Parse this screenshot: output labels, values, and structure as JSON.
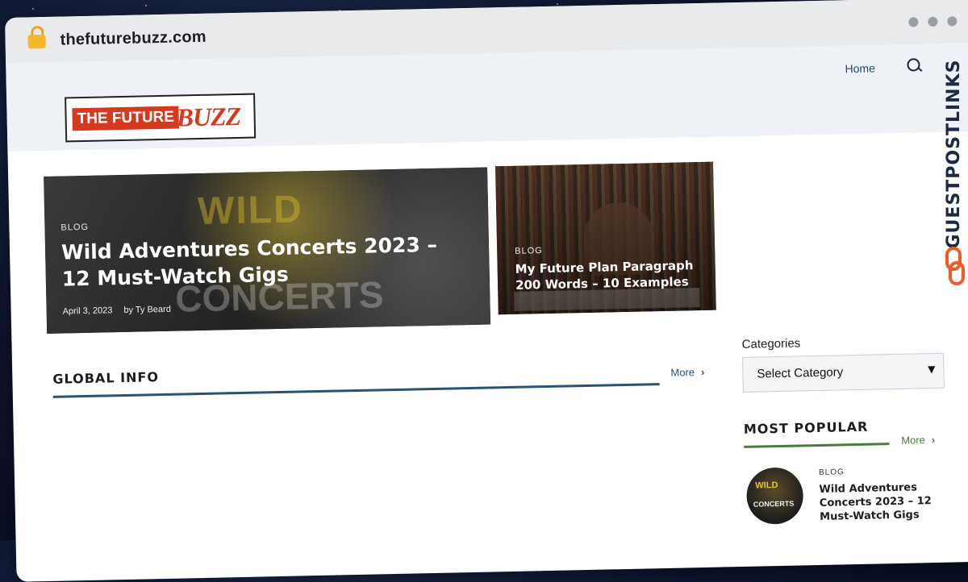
{
  "browser": {
    "url": "thefuturebuzz.com"
  },
  "header": {
    "logo_part1": "THE FUTURE",
    "logo_part2": "BUZZ",
    "nav_home": "Home"
  },
  "hero": {
    "category": "BLOG",
    "title": "Wild Adventures Concerts 2023 – 12 Must-Watch Gigs",
    "date": "April 3, 2023",
    "author": "by Ty Beard",
    "art_word1": "WILD",
    "art_word2": "CONCERTS"
  },
  "card2": {
    "category": "BLOG",
    "title": "My Future Plan Paragraph 200 Words – 10 Examples"
  },
  "section": {
    "title": "GLOBAL INFO",
    "more": "More"
  },
  "sidebar": {
    "categories_label": "Categories",
    "select_value": "Select Category",
    "most_popular_title": "MOST POPULAR",
    "more": "More",
    "item": {
      "category": "BLOG",
      "title": "Wild Adventures Concerts 2023 – 12 Must-Watch Gigs",
      "thumb_line1": "WILD",
      "thumb_line2": "CONCERTS"
    }
  },
  "watermark": {
    "text": "GUESTPOSTLINKS"
  },
  "colors": {
    "accent_blue": "#2a5372",
    "accent_green": "#4a7a3c",
    "brand_red": "#d63a1e",
    "watermark_orange": "#f05a28"
  }
}
